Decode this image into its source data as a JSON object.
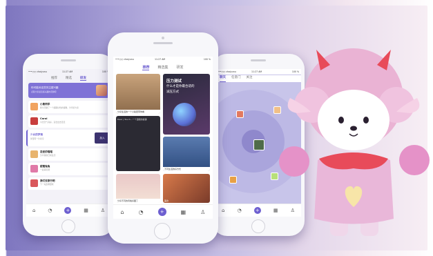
{
  "status_bar": {
    "carrier": "•••○○ chaiyunu",
    "time": "11:27 AM",
    "battery": "100 %"
  },
  "left_phone": {
    "tabs": [
      {
        "label": "推荐"
      },
      {
        "label": "精选"
      },
      {
        "label": "研发"
      }
    ],
    "banner": {
      "title": "你可能对这些关注感兴趣",
      "subtitle": "点赞大家最近感兴趣的话题吧"
    },
    "items": [
      {
        "name": "小熊同学",
        "text": "我今天做了一个超级好吃的蛋糕，分享给大家"
      },
      {
        "name": "Carol",
        "text": "今天天气真好，适合出去走走"
      },
      {
        "name": "少女的梦境",
        "text": "梦里有一片星空"
      },
      {
        "name": "恋爱的喵喵",
        "text": "分享我的日常生活"
      },
      {
        "name": "甜蜜兔兔",
        "text": "一起来玩吧"
      },
      {
        "name": "我们去旅行吧",
        "text": "下一站去哪里呢"
      }
    ],
    "join_button": "加入"
  },
  "middle_phone": {
    "tabs": [
      {
        "label": "推荐"
      },
      {
        "label": "精选集"
      },
      {
        "label": "研发"
      }
    ],
    "cards": [
      {
        "caption": "分享生活的一个小秘密带你看"
      },
      {
        "caption": "压力测试 什么才是你最合适的减压方式"
      },
      {
        "caption": "Dear | Touch...一个温暖的故事"
      },
      {
        "caption": "不同生活的好方式"
      },
      {
        "caption": "分享不同的风格好图了"
      },
      {
        "caption": "美食"
      }
    ],
    "headline": [
      "压力测试",
      "什么才是你最合适的",
      "减压方式"
    ]
  },
  "right_phone": {
    "tabs": [
      {
        "label": "聊天"
      },
      {
        "label": "任意门"
      },
      {
        "label": "关注"
      }
    ]
  },
  "colors": {
    "accent": "#6d5fd0",
    "banner": "#7f72d6",
    "mascot_pink": "#e7b3d6"
  }
}
